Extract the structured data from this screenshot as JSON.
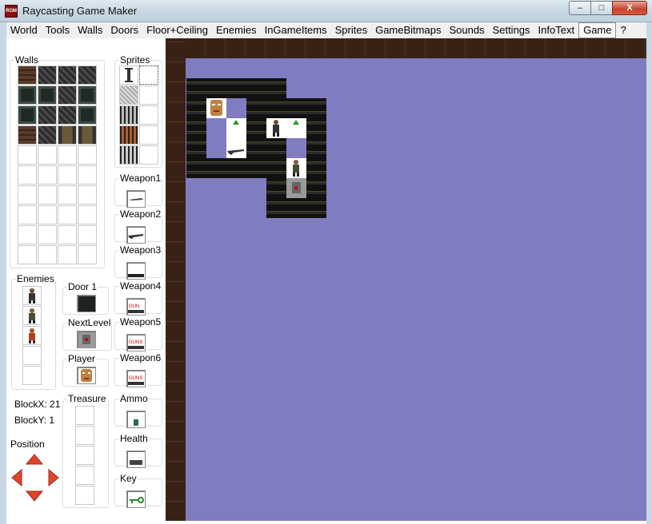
{
  "window": {
    "title": "Raycasting Game Maker",
    "icon_text": "RGM",
    "min": "–",
    "max": "□",
    "close": "X"
  },
  "menu": [
    {
      "label": "World"
    },
    {
      "label": "Tools"
    },
    {
      "label": "Walls"
    },
    {
      "label": "Doors"
    },
    {
      "label": "Floor+Ceiling"
    },
    {
      "label": "Enemies"
    },
    {
      "label": "InGameItems"
    },
    {
      "label": "Sprites"
    },
    {
      "label": "GameBitmaps"
    },
    {
      "label": "Sounds"
    },
    {
      "label": "Settings"
    },
    {
      "label": "InfoText"
    },
    {
      "label": "Game"
    },
    {
      "label": "?"
    }
  ],
  "panels": {
    "walls": "Walls",
    "sprites": "Sprites",
    "enemies": "Enemies",
    "door1": "Door 1",
    "nextlevel": "NextLevel",
    "player": "Player",
    "treasure": "Treasure",
    "weapon1": "Weapon1",
    "weapon2": "Weapon2",
    "weapon3": "Weapon3",
    "weapon4": "Weapon4",
    "weapon5": "Weapon5",
    "weapon6": "Weapon6",
    "ammo": "Ammo",
    "health": "Health",
    "key": "Key"
  },
  "weapon_icons": {
    "w4": "GUN",
    "w5": "GUNS",
    "w6": "GUNS"
  },
  "status": {
    "blockx": "BlockX: 21",
    "blocky": "BlockY: 1",
    "position": "Position"
  },
  "colors": {
    "viewport_bg": "#7f7dbf",
    "arrow": "#e0442a"
  }
}
